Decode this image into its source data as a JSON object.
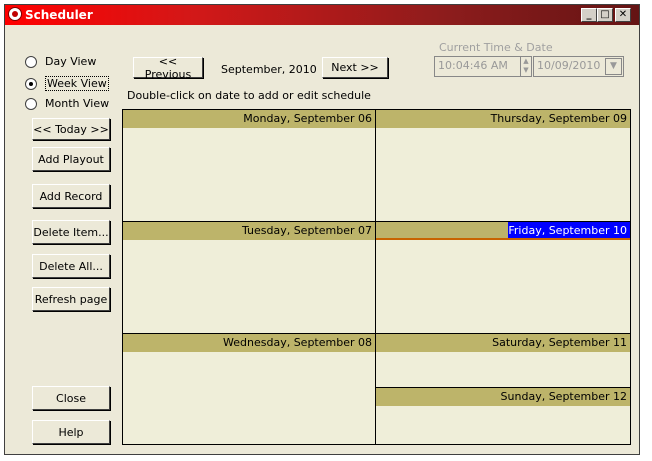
{
  "window": {
    "title": "Scheduler"
  },
  "view_modes": [
    {
      "label": "Day View",
      "selected": false
    },
    {
      "label": "Week View",
      "selected": true
    },
    {
      "label": "Month View",
      "selected": false
    }
  ],
  "nav": {
    "previous_label": "<< Previous",
    "month_label": "September, 2010",
    "next_label": "Next >>",
    "today_label": "<< Today >>",
    "hint": "Double-click on date to add or edit schedule"
  },
  "datetime": {
    "heading": "Current Time & Date",
    "time": "10:04:46 AM",
    "date": "10/09/2010"
  },
  "actions": {
    "add_playout": "Add Playout",
    "add_record": "Add Record",
    "delete_item": "Delete Item...",
    "delete_all": "Delete All...",
    "refresh": "Refresh page",
    "close": "Close",
    "help": "Help"
  },
  "days": [
    {
      "label": "Monday, September 06"
    },
    {
      "label": "Tuesday, September 07"
    },
    {
      "label": "Wednesday, September 08"
    },
    {
      "label": "Thursday, September 09"
    },
    {
      "label": "Friday, September 10"
    },
    {
      "label": "Saturday, September 11"
    },
    {
      "label": "Sunday, September 12"
    }
  ],
  "colors": {
    "titlebar": "#cc0000",
    "day_header": "#bdb46a",
    "selected_day": "#0000ff",
    "day_body": "#efeed9"
  }
}
